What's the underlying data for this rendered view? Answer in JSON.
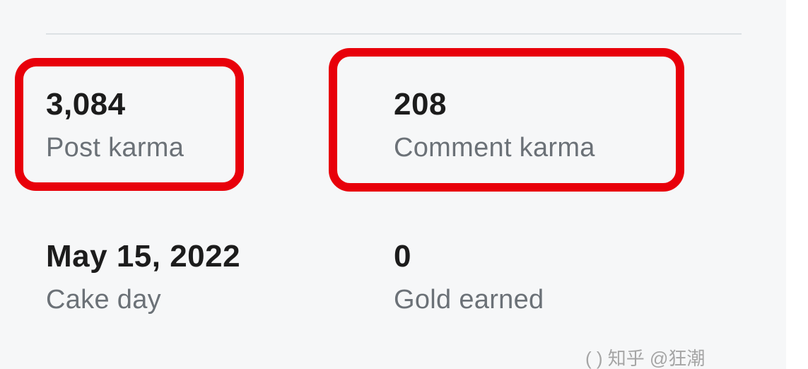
{
  "stats": {
    "post_karma": {
      "value": "3,084",
      "label": "Post karma"
    },
    "comment_karma": {
      "value": "208",
      "label": "Comment karma"
    },
    "cake_day": {
      "value": "May 15, 2022",
      "label": "Cake day"
    },
    "gold_earned": {
      "value": "0",
      "label": "Gold earned"
    }
  },
  "watermark": {
    "text": "( ) 知乎 @狂潮"
  },
  "colors": {
    "highlight": "#e8000a",
    "value_text": "#1c1c1c",
    "label_text": "#6b7177",
    "background": "#f6f7f8",
    "divider": "#dde1e4"
  }
}
